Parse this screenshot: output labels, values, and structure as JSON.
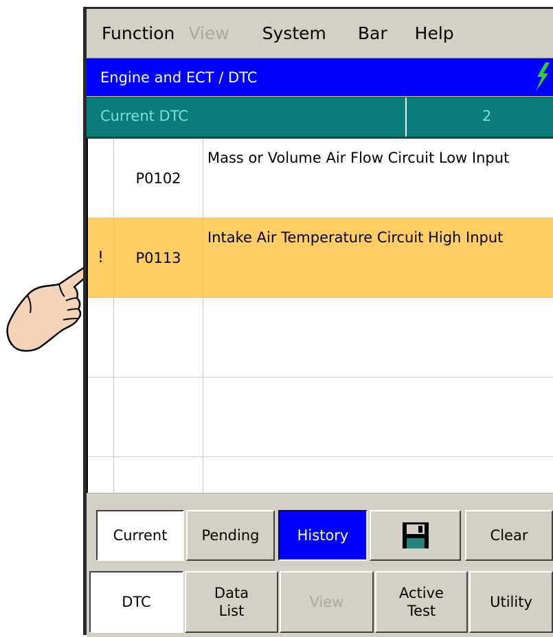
{
  "menu": {
    "function": "Function",
    "view": "View",
    "system": "System",
    "bar": "Bar",
    "help": "Help"
  },
  "title": "Engine and ECT / DTC",
  "status": {
    "label": "Current DTC",
    "count": "2"
  },
  "dtc_rows": [
    {
      "flag": "",
      "code": "P0102",
      "description": "Mass or Volume Air Flow Circuit Low Input",
      "selected": false
    },
    {
      "flag": "!",
      "code": "P0113",
      "description": "Intake Air Temperature Circuit High Input",
      "selected": true
    },
    {
      "flag": "",
      "code": "",
      "description": ""
    },
    {
      "flag": "",
      "code": "",
      "description": ""
    },
    {
      "flag": "",
      "code": "",
      "description": ""
    }
  ],
  "function_buttons": {
    "current": "Current",
    "pending": "Pending",
    "history": "History",
    "save_icon": "floppy-disk-icon",
    "clear": "Clear"
  },
  "nav_buttons": {
    "dtc": "DTC",
    "data_list_1": "Data",
    "data_list_2": "List",
    "view": "View",
    "active_test_1": "Active",
    "active_test_2": "Test",
    "utility": "Utility"
  },
  "colors": {
    "title_bg": "#0000ff",
    "status_bg": "#0c7c78",
    "selected_row": "#ffcc66",
    "bolt": "#33cc33"
  }
}
